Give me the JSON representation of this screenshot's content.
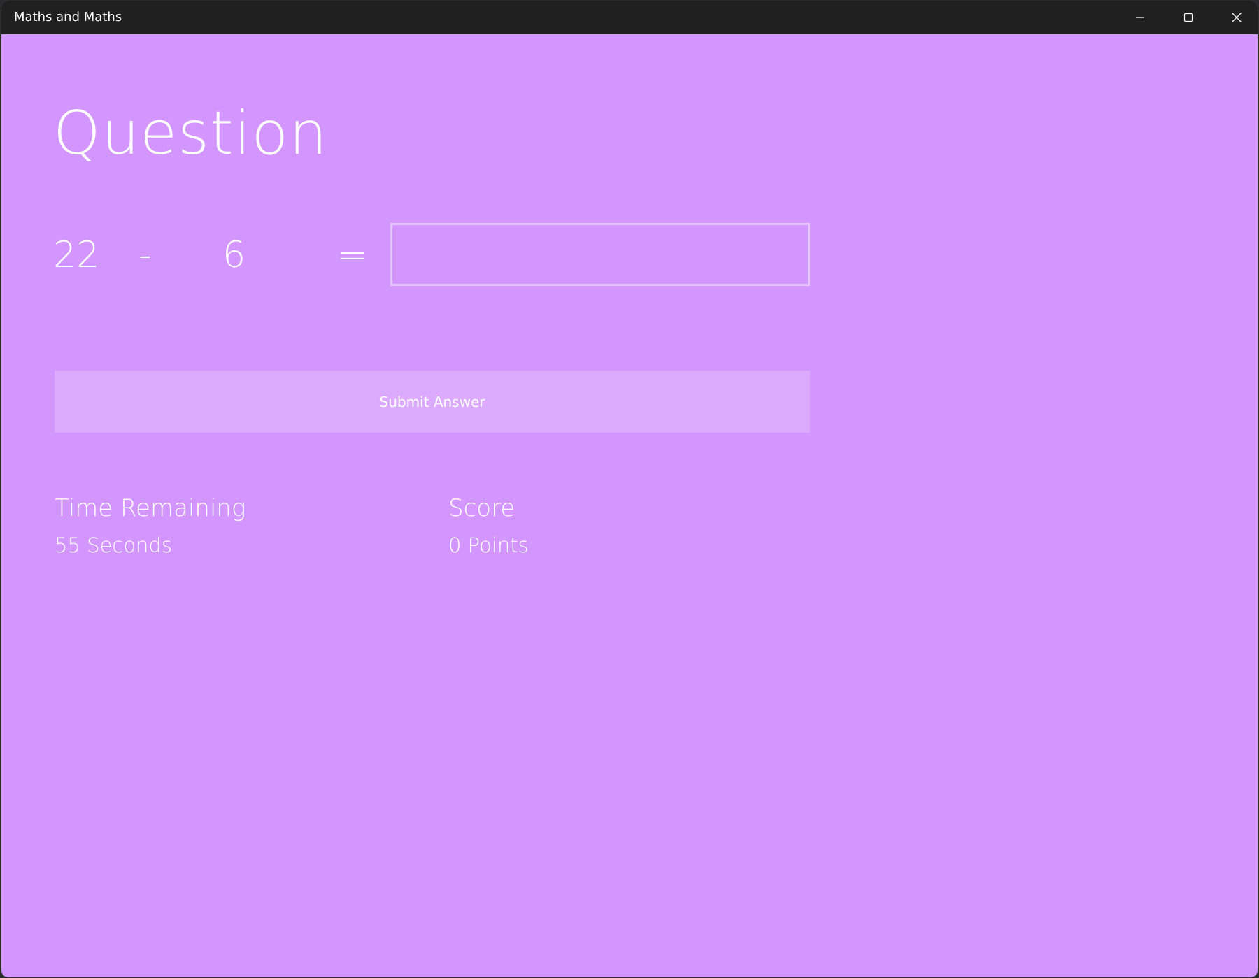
{
  "window": {
    "title": "Maths and Maths",
    "controls": {
      "minimize_icon": "minimize-icon",
      "maximize_icon": "maximize-icon",
      "close_icon": "close-icon"
    }
  },
  "question": {
    "heading": "Question",
    "operand_a": "22",
    "operator": "-",
    "operand_b": "6",
    "equals": "=",
    "answer_value": ""
  },
  "actions": {
    "submit_label": "Submit Answer"
  },
  "stats": {
    "time_label": "Time Remaining",
    "time_value": "55 Seconds",
    "score_label": "Score",
    "score_value": "0 Points"
  },
  "colors": {
    "background": "#d396fe",
    "titlebar": "#202020",
    "button": "#dbaafe",
    "input_border": "#e6c4ff",
    "text": "#ffffff"
  }
}
